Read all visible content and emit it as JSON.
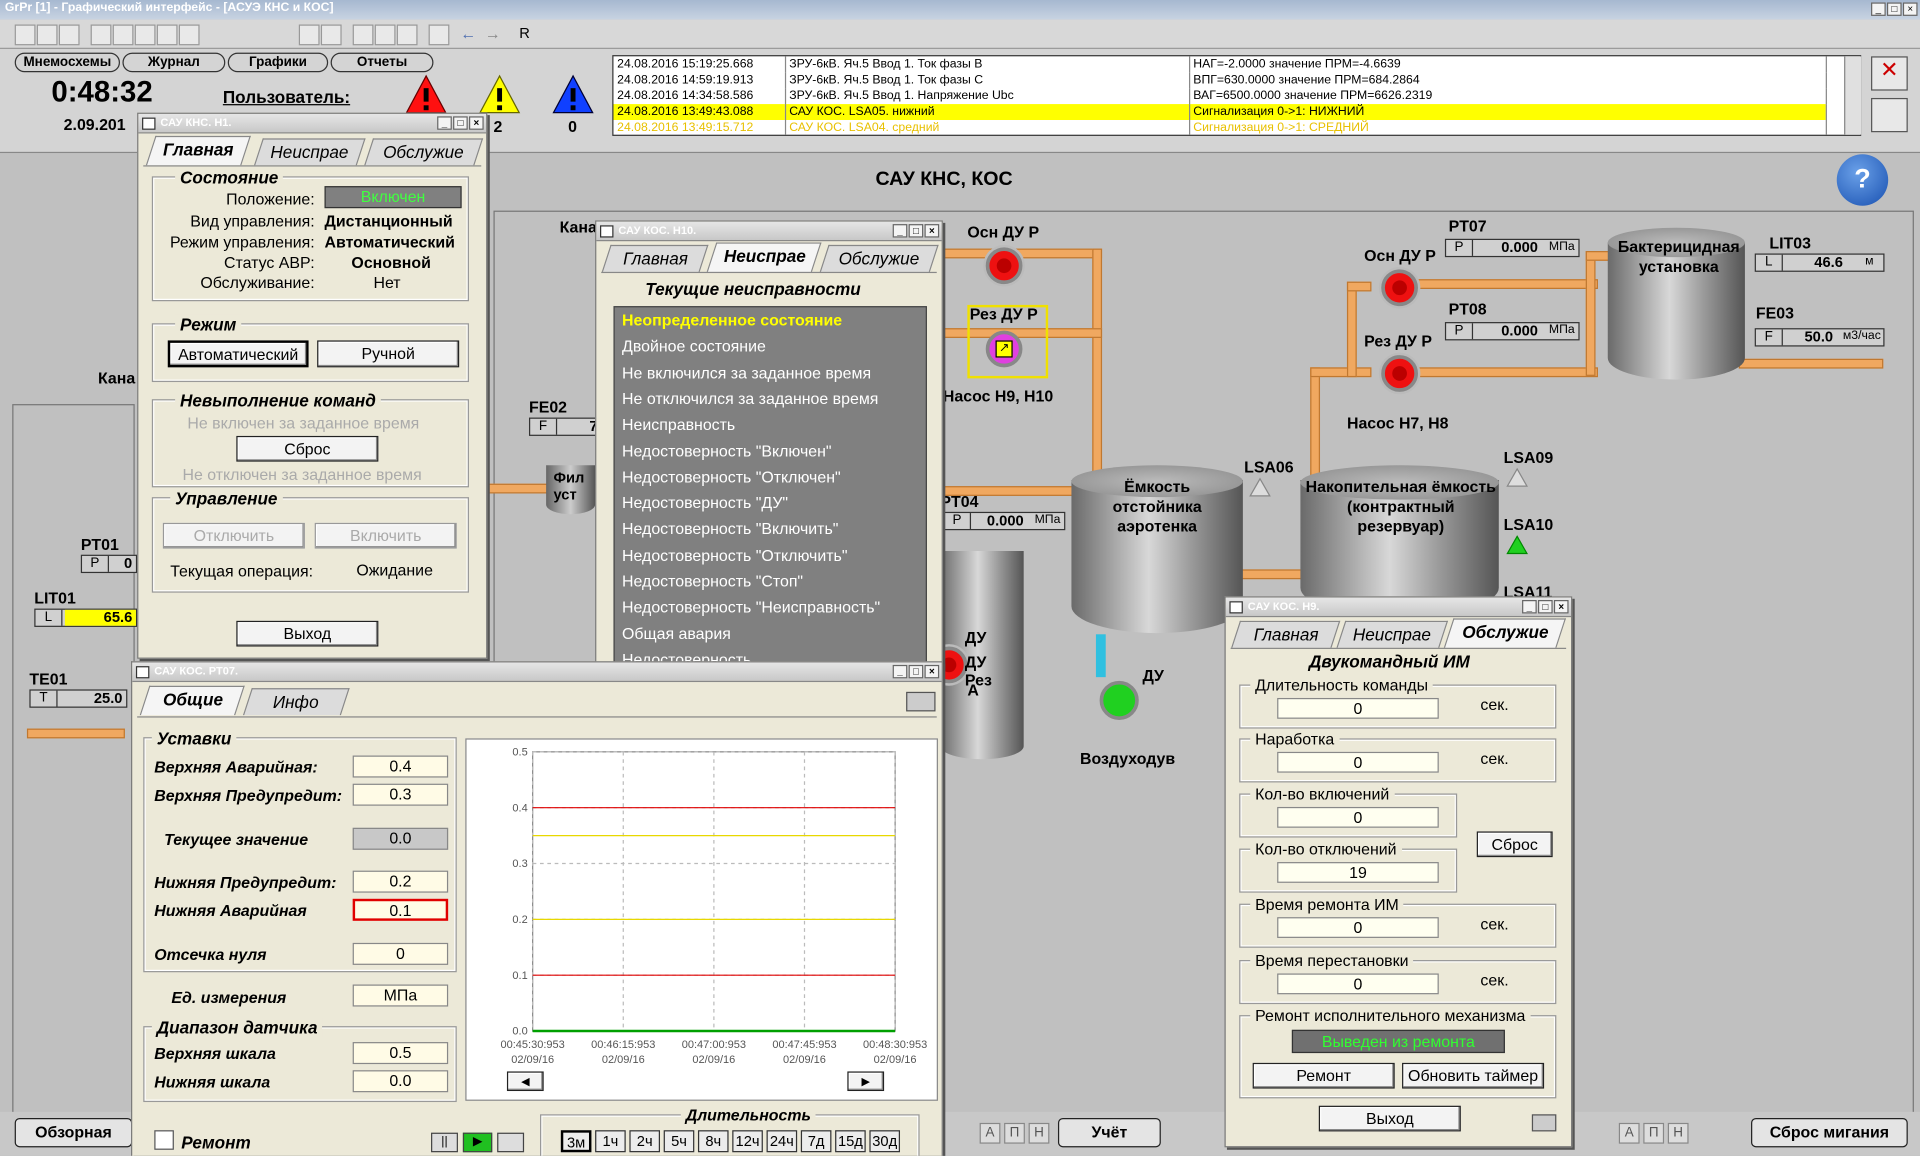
{
  "app": {
    "title": "GrPr [1] - Графический интерфейс - [АСУЭ КНС и КОС]"
  },
  "menu_tabs": [
    "Мнемосхемы",
    "Журнал",
    "Графики",
    "Отчеты"
  ],
  "clock": "0:48:32",
  "date": "2.09.201",
  "user_label": "Пользователь:",
  "alarm_counts": {
    "yellow": "2",
    "blue": "0"
  },
  "events": [
    [
      "24.08.2016 15:19:25.668",
      "ЗРУ-6кВ. Яч.5 Ввод 1. Ток фазы В",
      "НАГ=-2.0000  значение ПРМ=-4.6639"
    ],
    [
      "24.08.2016 14:59:19.913",
      "ЗРУ-6кВ. Яч.5 Ввод 1. Ток фазы С",
      "ВПГ=630.0000  значение ПРМ=684.2864"
    ],
    [
      "24.08.2016 14:34:58.586",
      "ЗРУ-6кВ. Яч.5 Ввод 1. Напряжение Ubc",
      "ВАГ=6500.0000  значение ПРМ=6626.2319"
    ],
    [
      "24.08.2016 13:49:43.088",
      "САУ КОС. LSA05. нижний",
      "Сигнализация  0->1:   НИЖНИЙ"
    ],
    [
      "24.08.2016 13:49:15.712",
      "САУ КОС. LSA04. средний",
      "Сигнализация  0->1:   СРЕДНИЙ"
    ]
  ],
  "scheme": {
    "title": "САУ КНС, КОС",
    "labels": {
      "kana1": "Кана",
      "kana2": "Кана",
      "osn_du_p1": "Осн ДУ Р",
      "rez_du_p1": "Рез ДУ Р",
      "nasos_h9": "Насос Н9, Н10",
      "osn_du_p2": "Осн ДУ Р",
      "rez_du_p2": "Рез ДУ Р",
      "nasos_h7": "Насос Н7, Н8",
      "emkost": "Ёмкость отстойника аэротенка",
      "nakop": "Накопительная ёмкость (контрактный резервуар)",
      "bakt": "Бактерицидная установка",
      "lsa06": "LSA06",
      "lsa09": "LSA09",
      "lsa10": "LSA10",
      "lsa11": "LSA11",
      "du1": "ДУ",
      "du_rez": "ДУ Рез",
      "a": "А",
      "du2": "ДУ",
      "vozd": "Воздуходув",
      "fil": "Фил уст",
      "fe02": "FE02",
      "pt04": "PT04",
      "pt07": "PT07",
      "pt08": "PT08",
      "lit03": "LIT03",
      "fe03": "FE03",
      "pt01": "PT01",
      "lit01": "LIT01",
      "te01": "TE01"
    },
    "pt07": {
      "k": "P",
      "v": "0.000",
      "u": "МПа"
    },
    "pt08": {
      "k": "P",
      "v": "0.000",
      "u": "МПа"
    },
    "pt04": {
      "k": "P",
      "v": "0.000",
      "u": "МПа"
    },
    "lit03": {
      "k": "L",
      "v": "46.6",
      "u": "м"
    },
    "fe03": {
      "k": "F",
      "v": "50.0",
      "u": "м3/час"
    },
    "fe02": {
      "k": "F",
      "v": "7"
    },
    "pt01": {
      "k": "P",
      "v": "0"
    },
    "lit01": {
      "k": "L",
      "v": "65.6"
    },
    "te01": {
      "k": "T",
      "v": "25.0"
    }
  },
  "w_h1": {
    "title": "САУ КНС. Н1.",
    "tabs": [
      "Главная",
      "Неиспрае",
      "Обслужие"
    ],
    "g_state": "Состояние",
    "state": [
      [
        "Положение:",
        "Включен"
      ],
      [
        "Вид управления:",
        "Дистанционный"
      ],
      [
        "Режим управления:",
        "Автоматический"
      ],
      [
        "Статус АВР:",
        "Основной"
      ],
      [
        "Обслуживание:",
        "Нет"
      ]
    ],
    "g_mode": "Режим",
    "mode_auto": "Автоматический",
    "mode_man": "Ручной",
    "g_fail": "Невыполнение команд",
    "fail1": "Не включен за заданное время",
    "reset": "Сброс",
    "fail2": "Не отключен за заданное время",
    "g_ctrl": "Управление",
    "off": "Отключить",
    "on": "Включить",
    "op_label": "Текущая операция:",
    "op_value": "Ожидание",
    "exit": "Выход"
  },
  "w_h10": {
    "title": "САУ КОС. Н10.",
    "tabs": [
      "Главная",
      "Неиспрае",
      "Обслужие"
    ],
    "header": "Текущие неисправности",
    "faults": [
      "Неопределенное состояние",
      "Двойное состояние",
      "Не включился за заданное время",
      "Не отключился за заданное время",
      "Неисправность",
      "Недостоверность \"Включен\"",
      "Недостоверность \"Отключен\"",
      "Недостоверность \"ДУ\"",
      "Недостоверность \"Включить\"",
      "Недостоверность \"Отключить\"",
      "Недостоверность \"Стоп\"",
      "Недостоверность \"Неисправность\"",
      "Общая авария",
      "Недостоверность"
    ]
  },
  "w_pt07": {
    "title": "САУ КОС. РТ07.",
    "tabs": [
      "Общие",
      "Инфо"
    ],
    "g_set": "Уставки",
    "settings": [
      [
        "Верхняя Аварийная:",
        "0.4"
      ],
      [
        "Верхняя Предупредит:",
        "0.3"
      ],
      [
        "Текущее значение",
        "0.0"
      ],
      [
        "Нижняя Предупредит:",
        "0.2"
      ],
      [
        "Нижняя Аварийная",
        "0.1"
      ],
      [
        "Отсечка нуля",
        "0"
      ]
    ],
    "unit_label": "Ед. измерения",
    "unit": "МПа",
    "g_range": "Диапазон датчика",
    "range": [
      [
        "Верхняя шкала",
        "0.5"
      ],
      [
        "Нижняя шкала",
        "0.0"
      ]
    ],
    "repair": "Ремонт",
    "dur_label": "Длительность",
    "durations": [
      "3м",
      "1ч",
      "2ч",
      "5ч",
      "8ч",
      "12ч",
      "24ч",
      "7д",
      "15д",
      "30д"
    ]
  },
  "w_h9": {
    "title": "САУ КОС. Н9.",
    "tabs": [
      "Главная",
      "Неиспрае",
      "Обслужие"
    ],
    "header": "Двукомандный ИМ",
    "fields": [
      [
        "Длительность команды",
        "0",
        "сек."
      ],
      [
        "Наработка",
        "0",
        "сек."
      ],
      [
        "Кол-во включений",
        "0",
        ""
      ],
      [
        "Кол-во отключений",
        "19",
        ""
      ],
      [
        "Время ремонта ИМ",
        "0",
        "сек."
      ],
      [
        "Время перестановки",
        "0",
        "сек."
      ]
    ],
    "reset": "Сброс",
    "g_rep": "Ремонт исполнительного механизма",
    "rep_status": "Выведен из ремонта",
    "repair_btn": "Ремонт",
    "timer_btn": "Обновить таймер",
    "exit": "Выход"
  },
  "bottom": {
    "overview": "Обзорная",
    "uchet": "Учёт",
    "reset_blink": "Сброс мигания",
    "aph": [
      "А",
      "П",
      "Н"
    ]
  },
  "chart_data": {
    "type": "line",
    "x": [
      "00:45:30:953 02/09/16",
      "00:46:15:953 02/09/16",
      "00:47:00:953 02/09/16",
      "00:47:45:953 02/09/16",
      "00:48:30:953 02/09/16"
    ],
    "ylim": [
      0,
      0.5
    ],
    "yticks": [
      "0.5",
      "0.4",
      "0.3",
      "0.2",
      "0.1",
      "0.0"
    ],
    "series": [
      {
        "values": [
          0,
          0,
          0,
          0,
          0
        ],
        "color": "#00a000"
      }
    ],
    "limits": [
      {
        "value": 0.4,
        "color": "#e00000"
      },
      {
        "value": 0.35,
        "color": "#e8d800"
      },
      {
        "value": 0.2,
        "color": "#e8d800"
      },
      {
        "value": 0.1,
        "color": "#e00000"
      }
    ]
  }
}
